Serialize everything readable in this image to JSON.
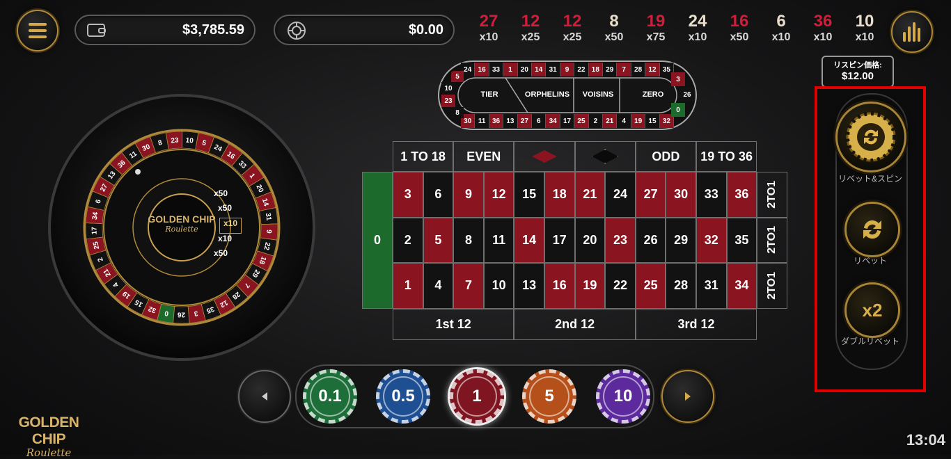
{
  "header": {
    "menu_icon": "hamburger-icon",
    "balance": "$3,785.59",
    "balance_icon": "wallet-icon",
    "bet": "$0.00",
    "bet_icon": "chip-icon",
    "stats_icon": "bar-chart-icon"
  },
  "history": [
    {
      "num": "27",
      "mul": "x10",
      "color": "red"
    },
    {
      "num": "12",
      "mul": "x25",
      "color": "red"
    },
    {
      "num": "12",
      "mul": "x25",
      "color": "red"
    },
    {
      "num": "8",
      "mul": "x50",
      "color": "light"
    },
    {
      "num": "19",
      "mul": "x75",
      "color": "red"
    },
    {
      "num": "24",
      "mul": "x10",
      "color": "light"
    },
    {
      "num": "16",
      "mul": "x50",
      "color": "red"
    },
    {
      "num": "6",
      "mul": "x10",
      "color": "light"
    },
    {
      "num": "36",
      "mul": "x10",
      "color": "red"
    },
    {
      "num": "10",
      "mul": "x10",
      "color": "light"
    }
  ],
  "respin": {
    "label": "リスピン価格:",
    "value": "$12.00"
  },
  "racetrack": {
    "top": [
      "24",
      "16",
      "33",
      "1",
      "20",
      "14",
      "31",
      "9",
      "22",
      "18",
      "29",
      "7",
      "28",
      "12",
      "35"
    ],
    "bottom": [
      "30",
      "11",
      "36",
      "13",
      "27",
      "6",
      "34",
      "17",
      "25",
      "2",
      "21",
      "4",
      "19",
      "15",
      "32"
    ],
    "left": [
      "5",
      "10",
      "23",
      "8"
    ],
    "right": [
      "3",
      "26",
      "0"
    ],
    "sections": [
      "TIER",
      "ORPHELINS",
      "VOISINS",
      "ZERO"
    ]
  },
  "wheel": {
    "logo_line1": "GOLDEN CHIP",
    "logo_line2": "Roulette",
    "multipliers": [
      "x50",
      "x50",
      "x10",
      "x10",
      "x50"
    ]
  },
  "table": {
    "outside_top": [
      "1 TO 18",
      "EVEN",
      "",
      "",
      "ODD",
      "19 TO 36"
    ],
    "zero": "0",
    "rows": [
      [
        [
          "3",
          "red"
        ],
        [
          "6",
          "black"
        ],
        [
          "9",
          "red"
        ],
        [
          "12",
          "red"
        ],
        [
          "15",
          "black"
        ],
        [
          "18",
          "red"
        ],
        [
          "21",
          "red"
        ],
        [
          "24",
          "black"
        ],
        [
          "27",
          "red"
        ],
        [
          "30",
          "red"
        ],
        [
          "33",
          "black"
        ],
        [
          "36",
          "red"
        ]
      ],
      [
        [
          "2",
          "black"
        ],
        [
          "5",
          "red"
        ],
        [
          "8",
          "black"
        ],
        [
          "11",
          "black"
        ],
        [
          "14",
          "red"
        ],
        [
          "17",
          "black"
        ],
        [
          "20",
          "black"
        ],
        [
          "23",
          "red"
        ],
        [
          "26",
          "black"
        ],
        [
          "29",
          "black"
        ],
        [
          "32",
          "red"
        ],
        [
          "35",
          "black"
        ]
      ],
      [
        [
          "1",
          "red"
        ],
        [
          "4",
          "black"
        ],
        [
          "7",
          "red"
        ],
        [
          "10",
          "black"
        ],
        [
          "13",
          "black"
        ],
        [
          "16",
          "red"
        ],
        [
          "19",
          "red"
        ],
        [
          "22",
          "black"
        ],
        [
          "25",
          "red"
        ],
        [
          "28",
          "black"
        ],
        [
          "31",
          "black"
        ],
        [
          "34",
          "red"
        ]
      ]
    ],
    "columns": [
      "2TO1",
      "2TO1",
      "2TO1"
    ],
    "dozens": [
      "1st 12",
      "2nd 12",
      "3rd 12"
    ]
  },
  "chips": [
    {
      "label": "0.1",
      "color": "#1e6e3a"
    },
    {
      "label": "0.5",
      "color": "#1f4f93"
    },
    {
      "label": "1",
      "color": "#7e1520"
    },
    {
      "label": "5",
      "color": "#b5501b"
    },
    {
      "label": "10",
      "color": "#5c2a9c"
    }
  ],
  "chip_nav": {
    "prev_icon": "chevron-left-icon",
    "next_icon": "chevron-right-icon"
  },
  "actions": {
    "rebet_spin": "リベット&スピン",
    "rebet": "リベット",
    "double_rebet": "ダブルリベット",
    "double_icon_text": "x2"
  },
  "footer": {
    "logo_line1": "GOLDEN CHIP",
    "logo_line2": "Roulette",
    "time": "13:04"
  },
  "colors": {
    "gold": "#b08a3a",
    "red": "#8a1420",
    "green": "#1d6b2c",
    "highlight": "#e00000"
  }
}
